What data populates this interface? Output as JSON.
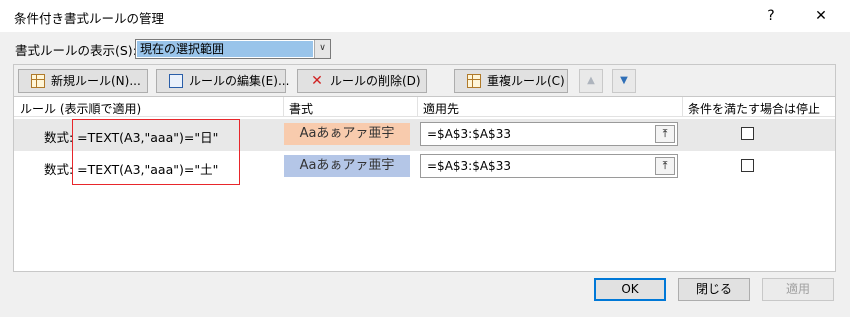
{
  "window": {
    "title": "条件付き書式ルールの管理",
    "help": "?",
    "close": "✕"
  },
  "show_rules": {
    "label": "書式ルールの表示(S):",
    "selected": "現在の選択範囲"
  },
  "toolbar": {
    "new_rule": "新規ルール(N)...",
    "edit_rule": "ルールの編集(E)...",
    "delete_rule": "ルールの削除(D)",
    "duplicate_rule": "重複ルール(C)",
    "move_up": "▲",
    "move_down": "▼"
  },
  "columns": {
    "rule": "ルール (表示順で適用)",
    "format": "書式",
    "applies_to": "適用先",
    "stop_if_true": "条件を満たす場合は停止"
  },
  "rules": [
    {
      "text": "数式: =TEXT(A3,\"aaa\")=\"日\"",
      "preview": "Aaあぁアァ亜宇",
      "preview_color": "#f8cbad",
      "applies_to": "=$A$3:$A$33",
      "collapse_icon": "⤒",
      "stop": false,
      "selected": true
    },
    {
      "text": "数式: =TEXT(A3,\"aaa\")=\"土\"",
      "preview": "Aaあぁアァ亜宇",
      "preview_color": "#b4c6e7",
      "applies_to": "=$A$3:$A$33",
      "collapse_icon": "⤒",
      "stop": false,
      "selected": false
    }
  ],
  "buttons": {
    "ok": "OK",
    "close": "閉じる",
    "apply": "適用"
  },
  "colors": {
    "highlight_box": "#e8262b",
    "ok_border": "#0078d7"
  }
}
